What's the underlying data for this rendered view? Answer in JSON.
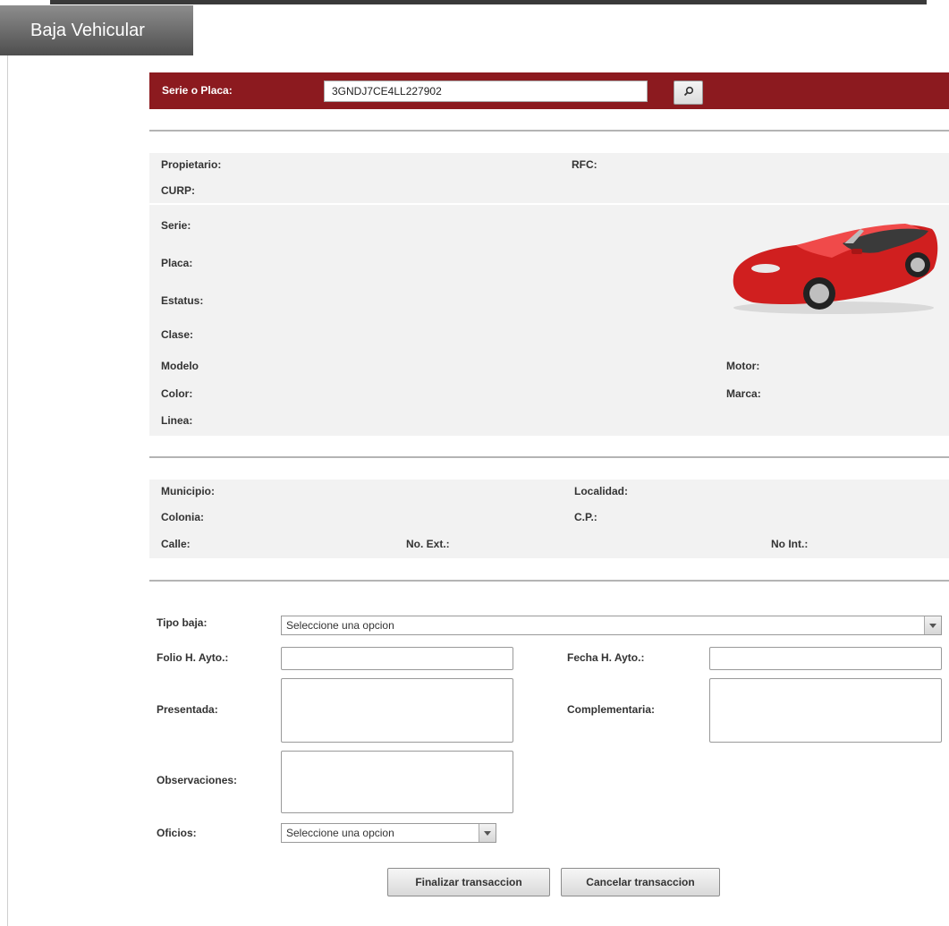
{
  "header": {
    "title": "Baja Vehicular"
  },
  "search": {
    "label": "Serie o Placa:",
    "value": "3GNDJ7CE4LL227902",
    "button_icon": "search-icon"
  },
  "owner": {
    "propietario": "Propietario:",
    "rfc": "RFC:",
    "curp": "CURP:"
  },
  "vehicle": {
    "serie": "Serie:",
    "placa": "Placa:",
    "estatus": "Estatus:",
    "clase": "Clase:",
    "modelo": "Modelo",
    "motor": "Motor:",
    "color": "Color:",
    "marca": "Marca:",
    "linea": "Linea:",
    "image": "red-convertible-car-image"
  },
  "address": {
    "municipio": "Municipio:",
    "localidad": "Localidad:",
    "colonia": "Colonia:",
    "cp": "C.P.:",
    "calle": "Calle:",
    "no_ext": "No. Ext.:",
    "no_int": "No Int.:"
  },
  "form": {
    "tipo_baja_label": "Tipo baja:",
    "tipo_baja_value": "Seleccione una opcion",
    "folio_label": "Folio H. Ayto.:",
    "fecha_label": "Fecha H. Ayto.:",
    "presentada_label": "Presentada:",
    "complementaria_label": "Complementaria:",
    "observaciones_label": "Observaciones:",
    "oficios_label": "Oficios:",
    "oficios_value": "Seleccione una opcion"
  },
  "actions": {
    "finalizar": "Finalizar transaccion",
    "cancelar": "Cancelar transaccion"
  },
  "colors": {
    "search_bar": "#8c1a1f",
    "panel": "#f2f2f2",
    "title_tab": "#6e6e6e"
  }
}
